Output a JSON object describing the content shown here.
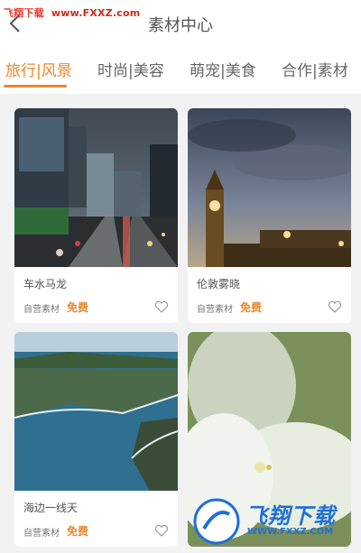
{
  "header": {
    "watermark_left": "飞翔下载",
    "watermark_url": "www.FXXZ.com",
    "title": "素材中心"
  },
  "tabs": [
    {
      "label": "旅行|风景",
      "active": true
    },
    {
      "label": "时尚|美容",
      "active": false
    },
    {
      "label": "萌宠|美食",
      "active": false
    },
    {
      "label": "合作|素材",
      "active": false
    }
  ],
  "cards": [
    {
      "title": "车水马龙",
      "source": "自营素材",
      "price": "免费",
      "image": "city-street"
    },
    {
      "title": "伦敦雾晓",
      "source": "自营素材",
      "price": "免费",
      "image": "big-ben"
    },
    {
      "title": "海边一线天",
      "source": "自营素材",
      "price": "免费",
      "image": "coastline"
    },
    {
      "title": "",
      "source": "",
      "price": "",
      "image": "white-flower"
    }
  ],
  "overlay_logo": {
    "text": "飞翔下载",
    "url": "WWW.FXXZ.COM"
  },
  "colors": {
    "accent": "#e8872e",
    "background": "#f2f2f2"
  }
}
